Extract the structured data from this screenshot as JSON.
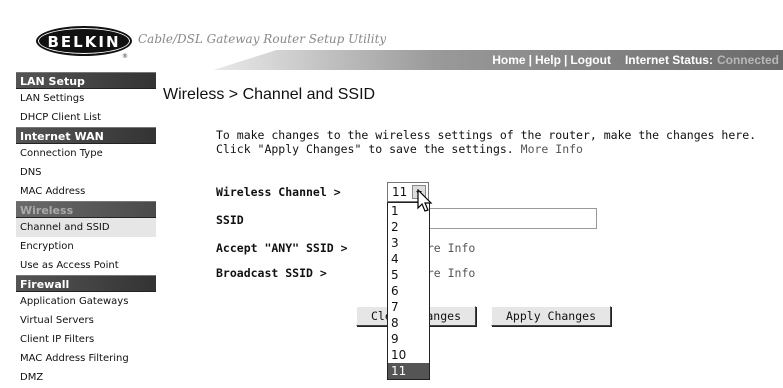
{
  "header": {
    "logo_text": "BELKIN",
    "logo_mark": "®",
    "subtitle": "Cable/DSL Gateway Router Setup Utility",
    "links": [
      "Home",
      "Help",
      "Logout"
    ],
    "link_separator": "|",
    "status_label": "Internet Status:",
    "status_value": "Connected"
  },
  "sidebar": {
    "sections": [
      {
        "title": "LAN Setup",
        "dim": false,
        "items": [
          "LAN Settings",
          "DHCP Client List"
        ]
      },
      {
        "title": "Internet WAN",
        "dim": false,
        "items": [
          "Connection Type",
          "DNS",
          "MAC Address"
        ]
      },
      {
        "title": "Wireless",
        "dim": true,
        "items": [
          "Channel and SSID",
          "Encryption",
          "Use as Access Point"
        ]
      },
      {
        "title": "Firewall",
        "dim": false,
        "items": [
          "Application Gateways",
          "Virtual Servers",
          "Client IP Filters",
          "MAC Address Filtering",
          "DMZ"
        ]
      }
    ],
    "active_item": "Channel and SSID"
  },
  "main": {
    "title": "Wireless > Channel and SSID",
    "intro_text": "To make changes to the wireless settings of the router, make the changes here. Click \"Apply Changes\" to save the settings.",
    "intro_link": "More Info",
    "fields": {
      "channel_label": "Wireless Channel >",
      "ssid_label": "SSID",
      "accept_any_label": "Accept \"ANY\" SSID >",
      "broadcast_label": "Broadcast SSID >",
      "more_info": "More Info"
    },
    "channel_select": {
      "value": "11",
      "options": [
        "1",
        "2",
        "3",
        "4",
        "5",
        "6",
        "7",
        "8",
        "9",
        "10",
        "11"
      ]
    },
    "buttons": {
      "clear": "Clear Changes",
      "apply": "Apply Changes"
    }
  },
  "colors": {
    "sidebar_header": "#333333",
    "selected_option": "#555555",
    "link": "#555555"
  },
  "icons": {
    "cursor": "mouse-pointer-icon",
    "dropdown": "chevron-down-icon"
  }
}
